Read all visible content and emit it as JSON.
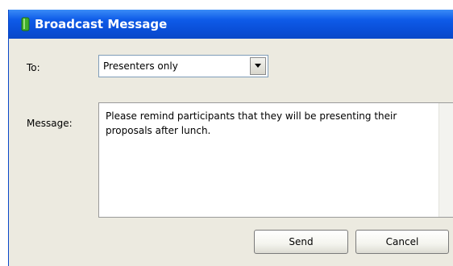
{
  "window": {
    "title": "Broadcast Message",
    "icon": "app-icon"
  },
  "form": {
    "to_label": "To:",
    "to_value": "Presenters only",
    "message_label": "Message:",
    "message_text": "Please remind participants that they will be presenting their proposals after lunch."
  },
  "buttons": {
    "send_label": "Send",
    "cancel_label": "Cancel"
  },
  "colors": {
    "titlebar": "#0a4fd8",
    "dialog_bg": "#eceae0",
    "icon_green": "#3fae2a"
  }
}
